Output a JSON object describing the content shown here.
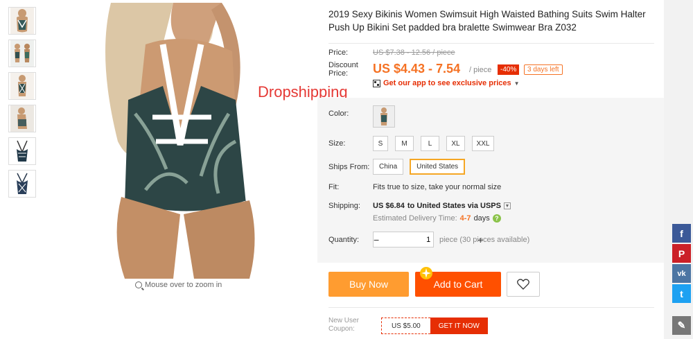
{
  "watermark": "Dropshipping",
  "zoom_hint": "Mouse over to zoom in",
  "product": {
    "title": "2019 Sexy Bikinis Women Swimsuit High Waisted Bathing Suits Swim Halter Push Up Bikini Set padded bra bralette Swimwear Bra Z032"
  },
  "price": {
    "label": "Price:",
    "original": "US $7.38 - 12.56 / piece",
    "discount_label_line1": "Discount",
    "discount_label_line2": "Price:",
    "discount": "US $4.43 - 7.54",
    "unit": "/ piece",
    "off_badge": "-40%",
    "time_left": "3 days left",
    "app_promo": "Get our app to see exclusive prices",
    "accent_color": "#f57224"
  },
  "options": {
    "color_label": "Color:",
    "size_label": "Size:",
    "sizes": [
      "S",
      "M",
      "L",
      "XL",
      "XXL"
    ],
    "ships_from_label": "Ships From:",
    "ships_from": [
      "China",
      "United States"
    ],
    "ships_from_selected": "United States",
    "fit_label": "Fit:",
    "fit_text": "Fits true to size, take your normal size"
  },
  "shipping": {
    "label": "Shipping:",
    "cost": "US $6.84",
    "destination": "to United States via USPS",
    "estimate_label": "Estimated Delivery Time:",
    "estimate_days": "4-7",
    "estimate_unit": "days"
  },
  "quantity": {
    "label": "Quantity:",
    "value": "1",
    "minus": "−",
    "plus": "+",
    "note": "piece (30 pieces available)"
  },
  "actions": {
    "buy_now": "Buy Now",
    "add_to_cart": "Add to Cart",
    "wishlist_icon": "heart-icon"
  },
  "coupon": {
    "label_line1": "New User",
    "label_line2": "Coupon:",
    "value": "US $5.00",
    "get": "GET IT NOW"
  },
  "social": [
    {
      "name": "facebook",
      "glyph": "f",
      "color": "#3b5998"
    },
    {
      "name": "pinterest",
      "glyph": "P",
      "color": "#cb2027"
    },
    {
      "name": "vk",
      "glyph": "vk",
      "color": "#4c75a3"
    },
    {
      "name": "twitter",
      "glyph": "t",
      "color": "#1da1f2"
    },
    {
      "name": "edit",
      "glyph": "✎",
      "color": "#777777"
    }
  ]
}
